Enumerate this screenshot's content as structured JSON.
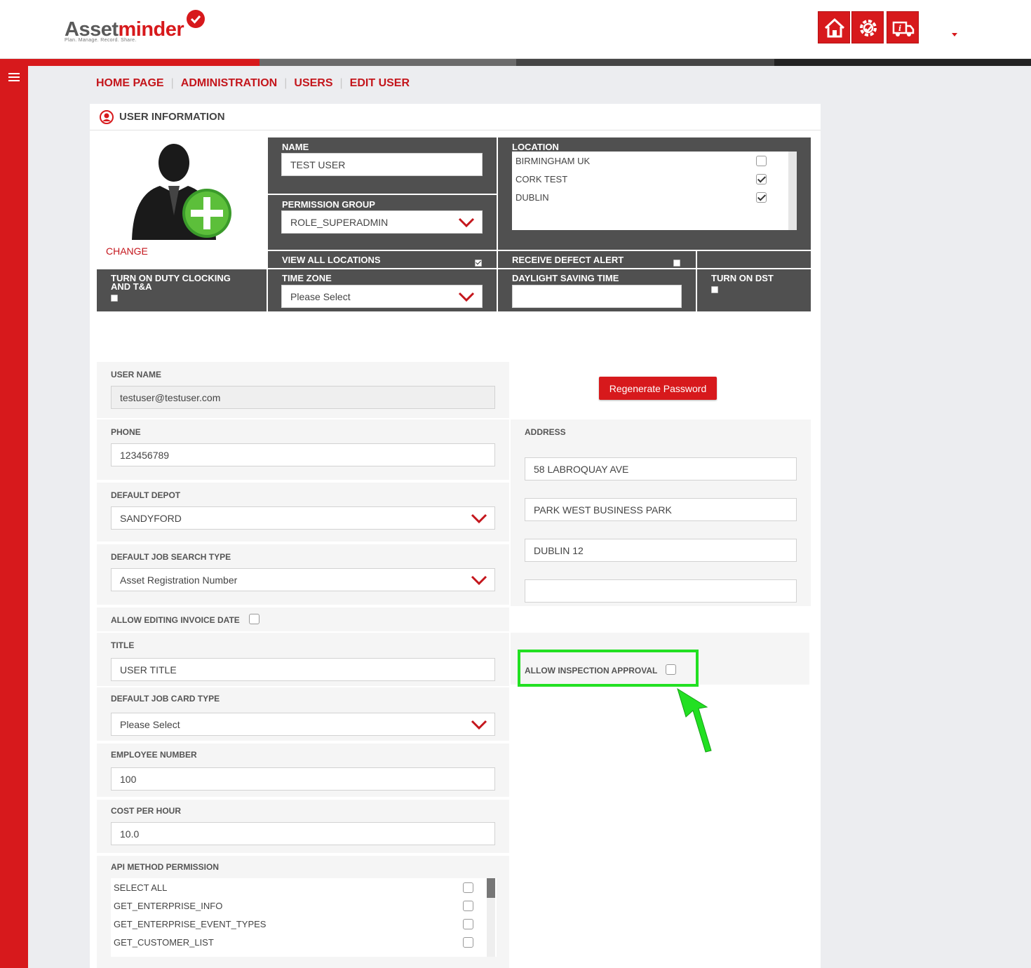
{
  "brand": {
    "name_a": "Asset",
    "name_b": "minder",
    "tagline": "Plan. Manage. Record. Share."
  },
  "top_icons": [
    "home-icon",
    "settings-icon",
    "truck-info-icon"
  ],
  "colors": {
    "accent": "#d7191c",
    "dark": "#505050",
    "highlight": "#22e022"
  },
  "breadcrumb": {
    "home": "HOME PAGE",
    "admin": "ADMINISTRATION",
    "users": "USERS",
    "edit": "EDIT USER"
  },
  "panel": {
    "title": "USER INFORMATION"
  },
  "profile": {
    "change": "CHANGE",
    "name_label": "NAME",
    "name_value": "TEST USER",
    "permission_label": "PERMISSION GROUP",
    "permission_value": "ROLE_SUPERADMIN",
    "location_label": "LOCATION",
    "locations": [
      {
        "name": "BIRMINGHAM UK",
        "checked": false
      },
      {
        "name": "CORK TEST",
        "checked": true
      },
      {
        "name": "DUBLIN",
        "checked": true
      }
    ],
    "view_all_label": "VIEW ALL LOCATIONS",
    "view_all_checked": true,
    "defect_label": "RECEIVE DEFECT ALERT",
    "defect_checked": false,
    "duty_label_1": "TURN ON DUTY CLOCKING",
    "duty_label_2": "AND T&A",
    "timezone_label": "TIME ZONE",
    "timezone_value": "Please Select",
    "dst_time_label": "DAYLIGHT SAVING TIME",
    "dst_time_value": "",
    "dst_label": "TURN ON DST"
  },
  "form": {
    "username_label": "USER NAME",
    "username_value": "testuser@testuser.com",
    "regen_label": "Regenerate Password",
    "phone_label": "PHONE",
    "phone_value": "123456789",
    "address_label": "ADDRESS",
    "address_lines": [
      "58 LABROQUAY AVE",
      "PARK WEST BUSINESS PARK",
      "DUBLIN 12",
      ""
    ],
    "depot_label": "DEFAULT DEPOT",
    "depot_value": "SANDYFORD",
    "job_search_label": "DEFAULT JOB SEARCH TYPE",
    "job_search_value": "Asset Registration Number",
    "invoice_label": "ALLOW EDITING INVOICE DATE",
    "title_label": "TITLE",
    "title_value": "USER TITLE",
    "inspection_label": "ALLOW INSPECTION APPROVAL",
    "job_card_label": "DEFAULT JOB CARD TYPE",
    "job_card_value": "Please Select",
    "employee_label": "EMPLOYEE NUMBER",
    "employee_value": "100",
    "cost_label": "COST PER HOUR",
    "cost_value": "10.0",
    "api_label": "API METHOD PERMISSION",
    "api_items": [
      "SELECT ALL",
      "GET_ENTERPRISE_INFO",
      "GET_ENTERPRISE_EVENT_TYPES",
      "GET_CUSTOMER_LIST"
    ]
  }
}
